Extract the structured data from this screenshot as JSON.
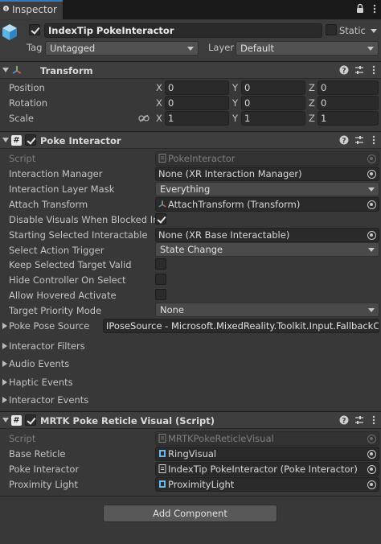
{
  "tab": {
    "title": "Inspector",
    "icon": "info-icon"
  },
  "object": {
    "name": "IndexTip PokeInteractor",
    "active": true,
    "static_label": "Static",
    "tag_label": "Tag",
    "tag_value": "Untagged",
    "layer_label": "Layer",
    "layer_value": "Default"
  },
  "transform": {
    "title": "Transform",
    "rows": [
      {
        "label": "Position",
        "x": "0",
        "y": "0",
        "z": "0"
      },
      {
        "label": "Rotation",
        "x": "0",
        "y": "0",
        "z": "0"
      },
      {
        "label": "Scale",
        "x": "1",
        "y": "1",
        "z": "1"
      }
    ],
    "axis_x": "X",
    "axis_y": "Y",
    "axis_z": "Z"
  },
  "poke": {
    "title": "Poke Interactor",
    "script_label": "Script",
    "script_value": "PokeInteractor",
    "interaction_manager_label": "Interaction Manager",
    "interaction_manager_value": "None (XR Interaction Manager)",
    "layer_mask_label": "Interaction Layer Mask",
    "layer_mask_value": "Everything",
    "attach_label": "Attach Transform",
    "attach_value": "AttachTransform (Transform)",
    "disable_visuals_label": "Disable Visuals When Blocked In G",
    "starting_label": "Starting Selected Interactable",
    "starting_value": "None (XR Base Interactable)",
    "trigger_label": "Select Action Trigger",
    "trigger_value": "State Change",
    "keep_label": "Keep Selected Target Valid",
    "hide_label": "Hide Controller On Select",
    "allow_label": "Allow Hovered Activate",
    "priority_label": "Target Priority Mode",
    "priority_value": "None",
    "pose_label": "Poke Pose Source",
    "pose_value": "IPoseSource - Microsoft.MixedReality.Toolkit.Input.FallbackC",
    "filters_label": "Interactor Filters",
    "audio_label": "Audio Events",
    "haptic_label": "Haptic Events",
    "events_label": "Interactor Events"
  },
  "reticle": {
    "title": "MRTK Poke Reticle Visual (Script)",
    "script_label": "Script",
    "script_value": "MRTKPokeReticleVisual",
    "base_label": "Base Reticle",
    "base_value": "RingVisual",
    "poke_label": "Poke Interactor",
    "poke_value": "IndexTip PokeInteractor (Poke Interactor)",
    "prox_label": "Proximity Light",
    "prox_value": "ProximityLight"
  },
  "add_component_label": "Add Component",
  "colors": {
    "background": "#383838",
    "tab_accent": "#3a79bb",
    "field": "#2a2a2a"
  }
}
